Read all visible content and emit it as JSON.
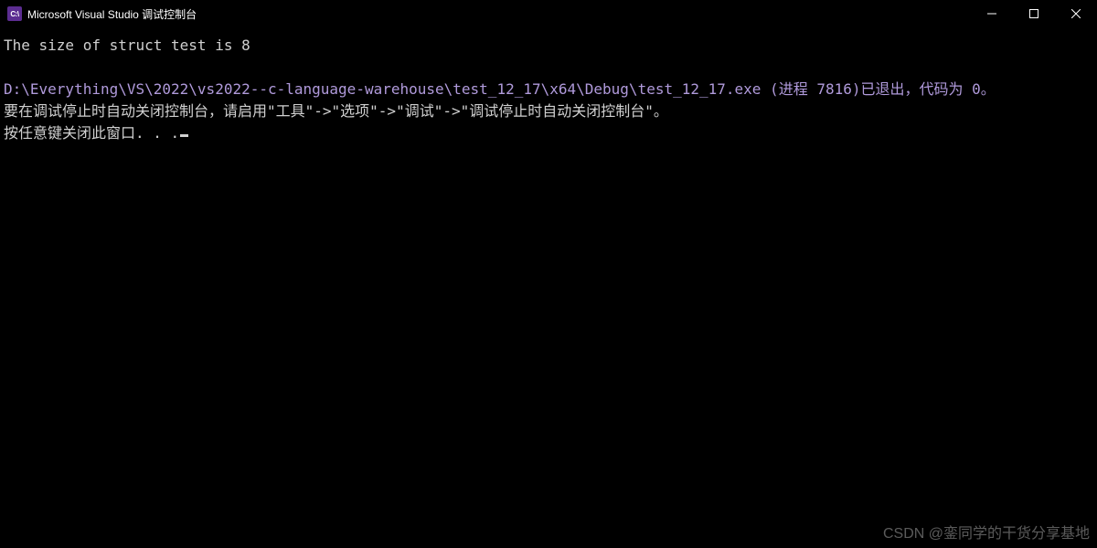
{
  "window": {
    "title": "Microsoft Visual Studio 调试控制台",
    "icon_text": "C:\\"
  },
  "console": {
    "output_line": "The size of struct test is 8",
    "path_line": "D:\\Everything\\VS\\2022\\vs2022--c-language-warehouse\\test_12_17\\x64\\Debug\\test_12_17.exe (进程 7816)已退出，代码为 0。",
    "hint_line": "要在调试停止时自动关闭控制台，请启用\"工具\"->\"选项\"->\"调试\"->\"调试停止时自动关闭控制台\"。",
    "prompt_line": "按任意键关闭此窗口. . ."
  },
  "watermark": "CSDN @銮同学的干货分享基地"
}
